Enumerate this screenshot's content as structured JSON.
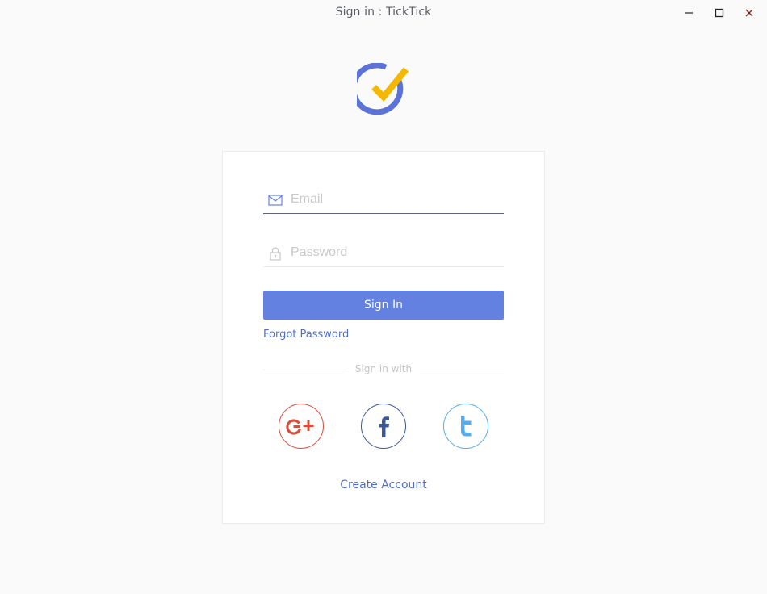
{
  "window": {
    "title": "Sign in : TickTick",
    "minimize_icon": "minimize-icon",
    "maximize_icon": "maximize-icon",
    "close_icon": "close-icon"
  },
  "logo": {
    "icon": "ticktick-logo-icon"
  },
  "form": {
    "email": {
      "placeholder": "Email",
      "value": "",
      "icon": "envelope-icon"
    },
    "password": {
      "placeholder": "Password",
      "value": "",
      "icon": "lock-icon"
    },
    "signin_label": "Sign In",
    "forgot_label": "Forgot Password",
    "signin_with_label": "Sign in with",
    "create_account_label": "Create Account"
  },
  "social": [
    {
      "name": "google-plus",
      "icon": "google-plus-icon",
      "color": "#dd4b39"
    },
    {
      "name": "facebook",
      "icon": "facebook-icon",
      "color": "#3b5998"
    },
    {
      "name": "twitter",
      "icon": "twitter-icon",
      "color": "#55acee"
    }
  ],
  "colors": {
    "accent": "#6381e0",
    "link": "#4f6fc9",
    "logo_ring": "#5b72d8",
    "logo_check": "#f5b800"
  }
}
